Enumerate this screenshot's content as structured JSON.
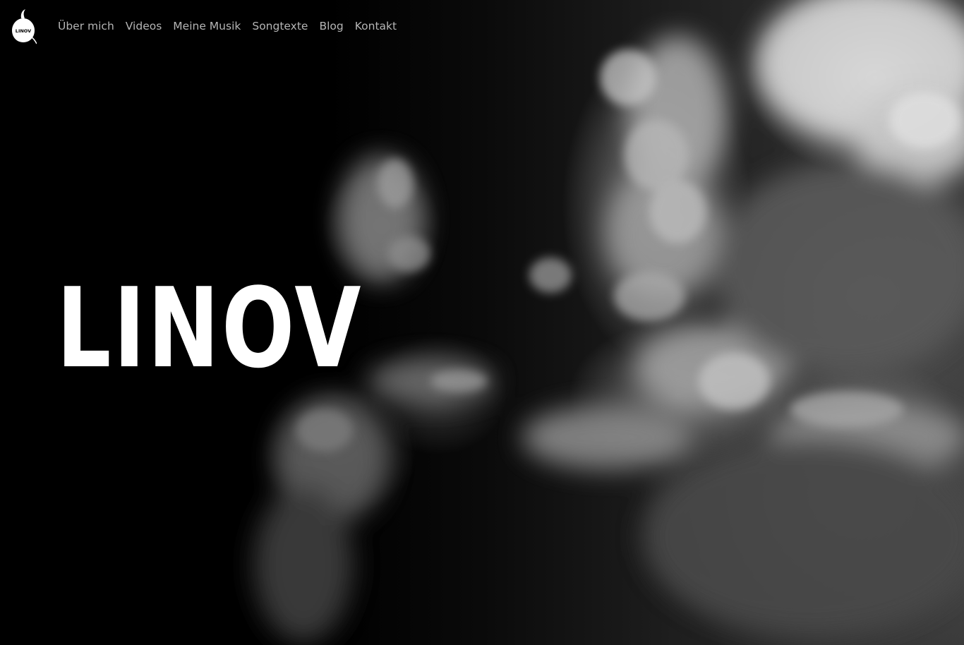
{
  "site": {
    "logo_text": "LINOV",
    "logo_icon": "linov-logo-icon"
  },
  "nav": {
    "items": [
      {
        "label": "Über mich"
      },
      {
        "label": "Videos"
      },
      {
        "label": "Meine Musik"
      },
      {
        "label": "Songtexte"
      },
      {
        "label": "Blog"
      },
      {
        "label": "Kontakt"
      }
    ]
  },
  "hero": {
    "title": "LINOV",
    "background_image": "dark-storm-clouds"
  },
  "colors": {
    "background": "#000000",
    "nav_text": "#b5b5b5",
    "title": "#ffffff"
  }
}
